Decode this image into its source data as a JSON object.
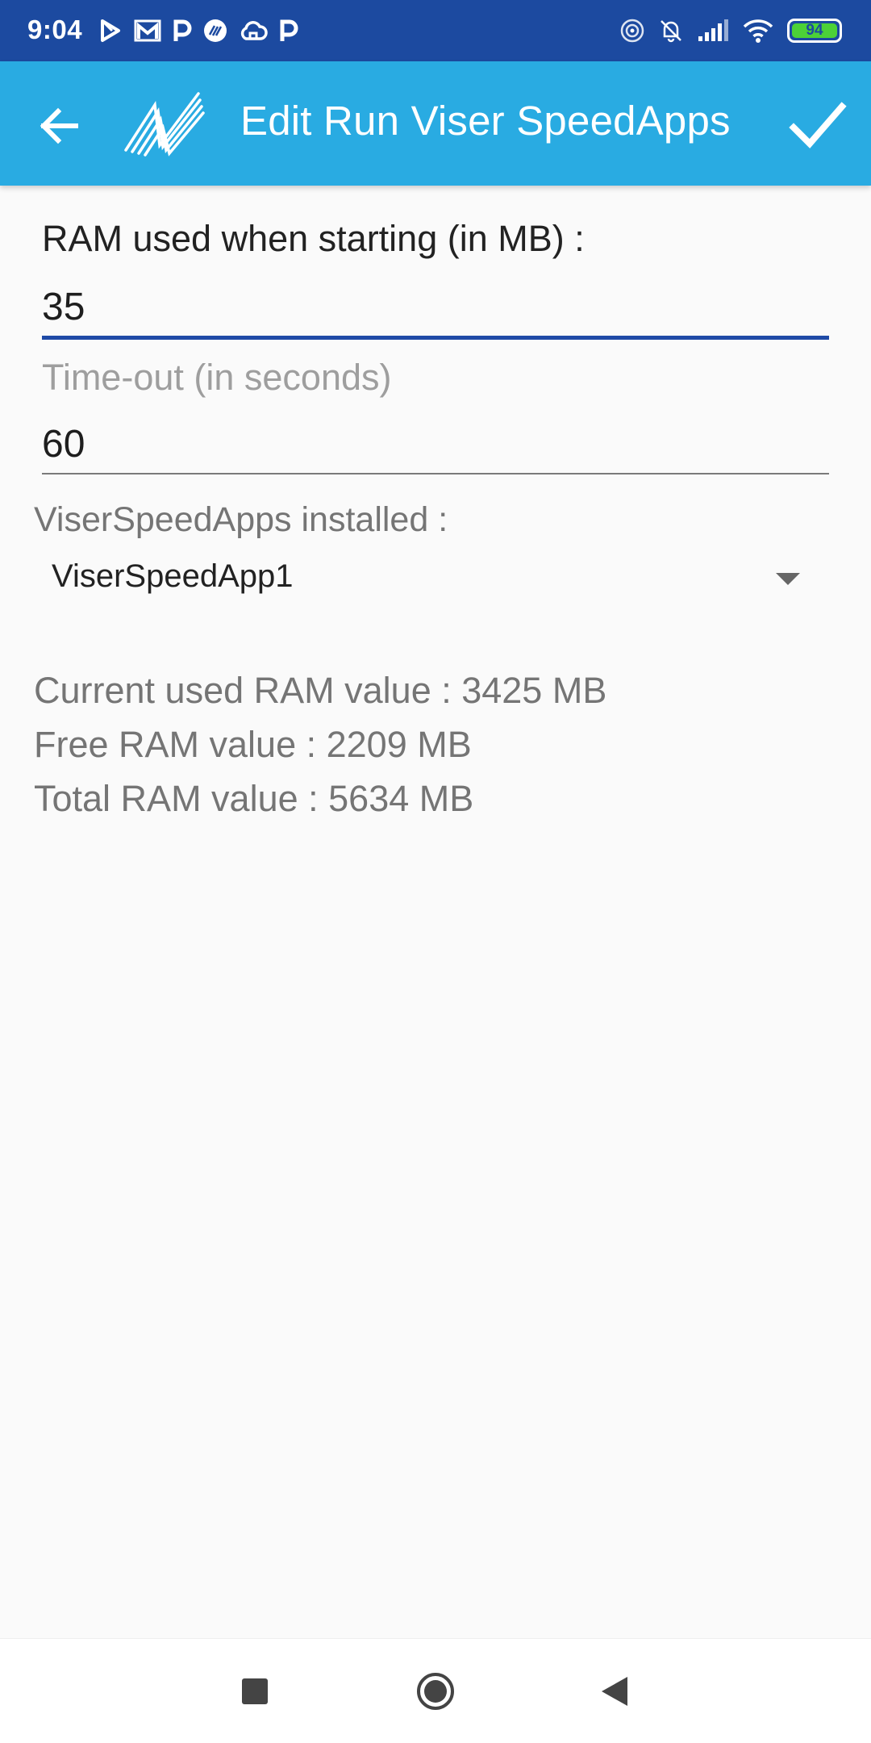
{
  "status_bar": {
    "time": "9:04",
    "left_icons": [
      "play-store-icon",
      "gmail-icon",
      "p-app-icon",
      "viser-icon",
      "cloud-icon",
      "p-app-icon"
    ],
    "right_icons": [
      "hotspot-icon",
      "muted-bell-icon",
      "signal-icon",
      "wifi-icon"
    ],
    "battery_level": "94",
    "battery_percent": 94
  },
  "app_bar": {
    "title": "Edit Run Viser SpeedApps",
    "background_color": "#29abe2",
    "status_color": "#1c4aa0"
  },
  "form": {
    "ram_label": "RAM used when starting (in MB) :",
    "ram_value": "35",
    "timeout_label": "Time-out (in seconds)",
    "timeout_value": "60",
    "installed_label": "ViserSpeedApps installed :",
    "installed_selected": "ViserSpeedApp1",
    "accent_color": "#1f4aa6"
  },
  "ram_info": {
    "current": "Current used RAM value : 3425 MB",
    "free": "Free RAM value : 2209 MB",
    "total": "Total RAM value : 5634 MB"
  }
}
